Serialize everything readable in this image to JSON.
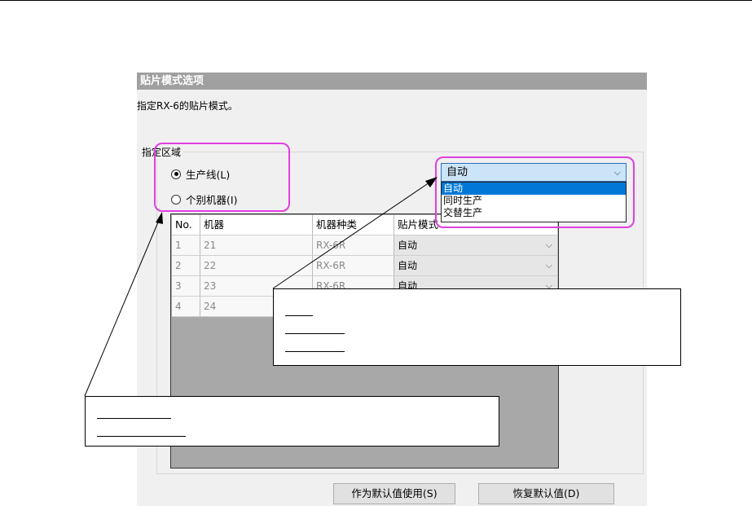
{
  "dialog": {
    "title": "贴片模式选项",
    "description": "指定RX-6的贴片模式。",
    "group_label": "指定区域",
    "radio_line": "生产线(L)",
    "radio_machine": "个别机器(I)",
    "mode_combo": {
      "value": "自动",
      "options": [
        "自动",
        "同时生产",
        "交替生产"
      ]
    },
    "table": {
      "headers": [
        "No.",
        "机器",
        "机器种类",
        "贴片模式"
      ],
      "rows": [
        [
          "1",
          "21",
          "RX-6R",
          "自动"
        ],
        [
          "2",
          "22",
          "RX-6R",
          "自动"
        ],
        [
          "3",
          "23",
          "RX-6R",
          "自动"
        ],
        [
          "4",
          "24",
          "",
          ""
        ]
      ]
    },
    "buttons": {
      "use_default": "作为默认值使用(S)",
      "restore_default": "恢复默认值(D)"
    }
  },
  "colors": {
    "highlight": "#e040e0",
    "selected": "#0078d7",
    "title_bar": "#a0a0a0"
  }
}
